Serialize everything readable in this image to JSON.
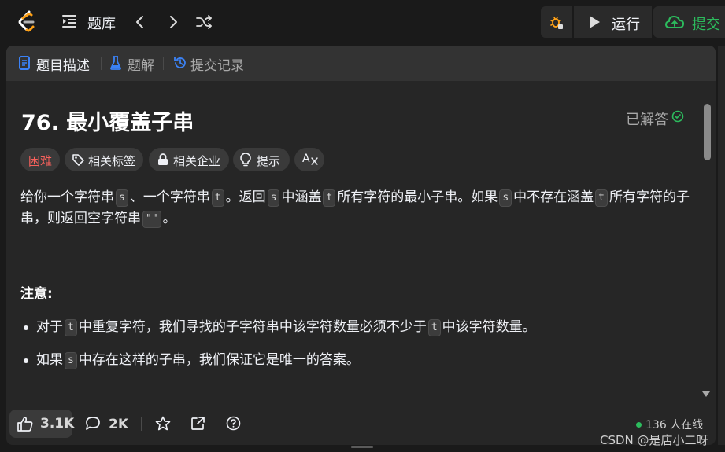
{
  "navbar": {
    "title": "题库",
    "run_label": "运行",
    "submit_label": "提交",
    "colors": {
      "submit": "#2cbb5d",
      "debug": "#ffa116",
      "logo": "#ffa116"
    }
  },
  "tabs": [
    {
      "label": "题目描述",
      "icon": "description-icon",
      "active": true
    },
    {
      "label": "题解",
      "icon": "flask-icon",
      "active": false
    },
    {
      "label": "提交记录",
      "icon": "history-icon",
      "active": false
    }
  ],
  "problem": {
    "title": "76. 最小覆盖子串",
    "status": "已解答",
    "tags": {
      "difficulty": "困难",
      "related_tags": "相关标签",
      "related_companies": "相关企业",
      "hint": "提示",
      "translate": "A"
    },
    "desc": {
      "p1": "给你一个字符串",
      "c1": "s",
      "p2": "、一个字符串",
      "c2": "t",
      "p3": "。返回",
      "c3": "s",
      "p4": "中涵盖",
      "c4": "t",
      "p5": "所有字符的最小子串。如果",
      "c5": "s",
      "p6": "中不存在涵盖",
      "c6": "t",
      "p7": "所有字符的子串，则返回空字符串",
      "c7": "\"\"",
      "p8": "。"
    },
    "note_title": "注意:",
    "bullets": {
      "b1a": "对于",
      "b1c1": "t",
      "b1b": "中重复字符，我们寻找的子字符串中该字符数量必须不少于",
      "b1c2": "t",
      "b1d": "中该字符数量。",
      "b2a": "如果",
      "b2c": "s",
      "b2b": "中存在这样的子串，我们保证它是唯一的答案。"
    }
  },
  "footer": {
    "likes": "3.1K",
    "comments": "2K",
    "online": "136 人在线"
  },
  "watermark": "CSDN @是店小二呀"
}
